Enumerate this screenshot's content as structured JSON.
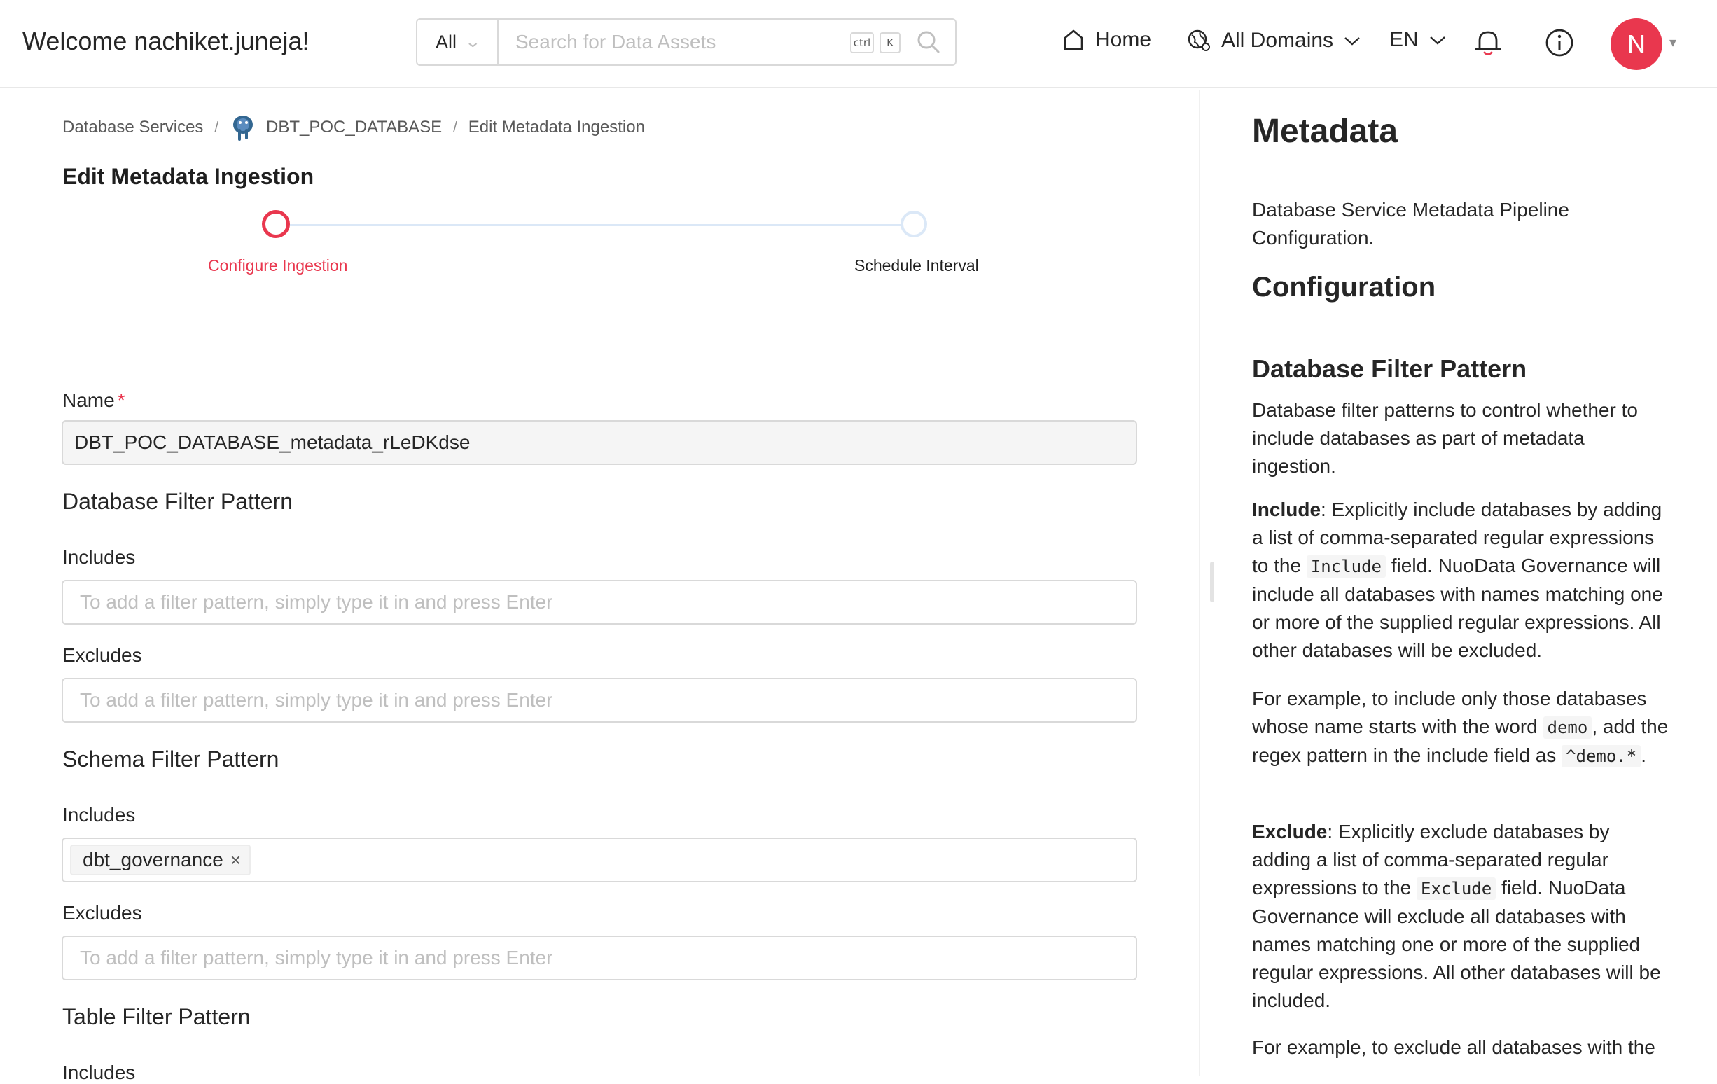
{
  "header": {
    "welcome": "Welcome nachiket.juneja!",
    "search_scope": "All",
    "search_placeholder": "Search for Data Assets",
    "kbd_ctrl": "ctrl",
    "kbd_k": "K",
    "nav_home": "Home",
    "nav_domains": "All Domains",
    "nav_lang": "EN",
    "avatar_initial": "N"
  },
  "breadcrumb": {
    "item1": "Database Services",
    "item2": "DBT_POC_DATABASE",
    "item3": "Edit Metadata Ingestion",
    "sep": "/"
  },
  "page": {
    "title": "Edit Metadata Ingestion"
  },
  "stepper": {
    "step1": "Configure Ingestion",
    "step2": "Schedule Interval",
    "active_step": 1
  },
  "form": {
    "name_label": "Name",
    "required_mark": "*",
    "name_value": "DBT_POC_DATABASE_metadata_rLeDKdse",
    "db_filter_title": "Database Filter Pattern",
    "schema_filter_title": "Schema Filter Pattern",
    "table_filter_title": "Table Filter Pattern",
    "includes_label": "Includes",
    "excludes_label": "Excludes",
    "placeholder": "To add a filter pattern, simply type it in and press Enter",
    "schema_include_tag": "dbt_governance",
    "tag_close": "×"
  },
  "doc": {
    "title": "Metadata",
    "intro": "Database Service Metadata Pipeline Configuration.",
    "config_title": "Configuration",
    "db_filter_title": "Database Filter Pattern",
    "db_filter_desc": "Database filter patterns to control whether to include databases as part of metadata ingestion.",
    "include_bold": "Include",
    "include_text1": ": Explicitly include databases by adding a list of comma-separated regular expressions to the ",
    "include_code": "Include",
    "include_text2": " field. NuoData Governance will include all databases with names matching one or more of the supplied regular expressions. All other databases will be excluded.",
    "example1_text1": "For example, to include only those databases whose name starts with the word ",
    "example1_code1": "demo",
    "example1_text2": ", add the regex pattern in the include field as ",
    "example1_code2": "^demo.*",
    "example1_text3": ".",
    "exclude_bold": "Exclude",
    "exclude_text1": ": Explicitly exclude databases by adding a list of comma-separated regular expressions to the ",
    "exclude_code": "Exclude",
    "exclude_text2": " field. NuoData Governance will exclude all databases with names matching one or more of the supplied regular expressions. All other databases will be included.",
    "example2_text": "For example, to exclude all databases with the"
  },
  "colors": {
    "accent": "#e9374e",
    "step_inactive": "#dbe8f7",
    "border": "#d9d9d9",
    "placeholder": "#bfbfbf"
  },
  "icons": {
    "search": "search-icon",
    "home": "home-icon",
    "domains": "globe-icon",
    "bell": "bell-icon",
    "info": "info-icon",
    "database": "postgres-icon"
  }
}
